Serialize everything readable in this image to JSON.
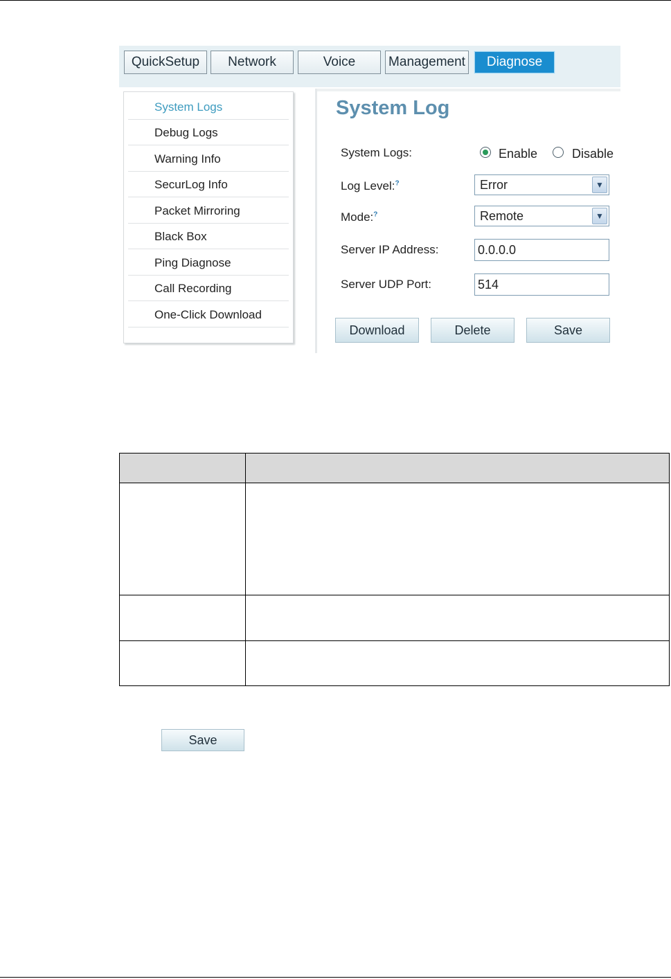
{
  "nav_tabs": [
    {
      "label": "QuickSetup",
      "active": false
    },
    {
      "label": "Network",
      "active": false
    },
    {
      "label": "Voice",
      "active": false
    },
    {
      "label": "Management",
      "active": false
    },
    {
      "label": "Diagnose",
      "active": true
    }
  ],
  "sidebar": {
    "items": [
      {
        "label": "System Logs",
        "active": true
      },
      {
        "label": "Debug Logs",
        "active": false
      },
      {
        "label": "Warning Info",
        "active": false
      },
      {
        "label": "SecurLog Info",
        "active": false
      },
      {
        "label": "Packet Mirroring",
        "active": false
      },
      {
        "label": "Black Box",
        "active": false
      },
      {
        "label": "Ping Diagnose",
        "active": false
      },
      {
        "label": "Call Recording",
        "active": false
      },
      {
        "label": "One-Click Download",
        "active": false
      }
    ]
  },
  "panel": {
    "title": "System Log",
    "system_logs_label": "System Logs:",
    "enable_label": "Enable",
    "disable_label": "Disable",
    "system_logs_value": "Enable",
    "log_level_label": "Log Level:",
    "log_level_value": "Error",
    "mode_label": "Mode:",
    "mode_value": "Remote",
    "server_ip_label": "Server IP Address:",
    "server_ip_value": "0.0.0.0",
    "server_udp_label": "Server UDP Port:",
    "server_udp_value": "514",
    "help_glyph": "?",
    "dropdown_glyph": "▼"
  },
  "buttons": {
    "download": "Download",
    "delete": "Delete",
    "save": "Save"
  },
  "doc": {
    "save_button_label": "Save"
  },
  "colors": {
    "active_tab": "#1a8dcf",
    "active_sidebar_text": "#3d9bbf",
    "title": "#5d8fae",
    "table_header": "#d9d9d9"
  }
}
